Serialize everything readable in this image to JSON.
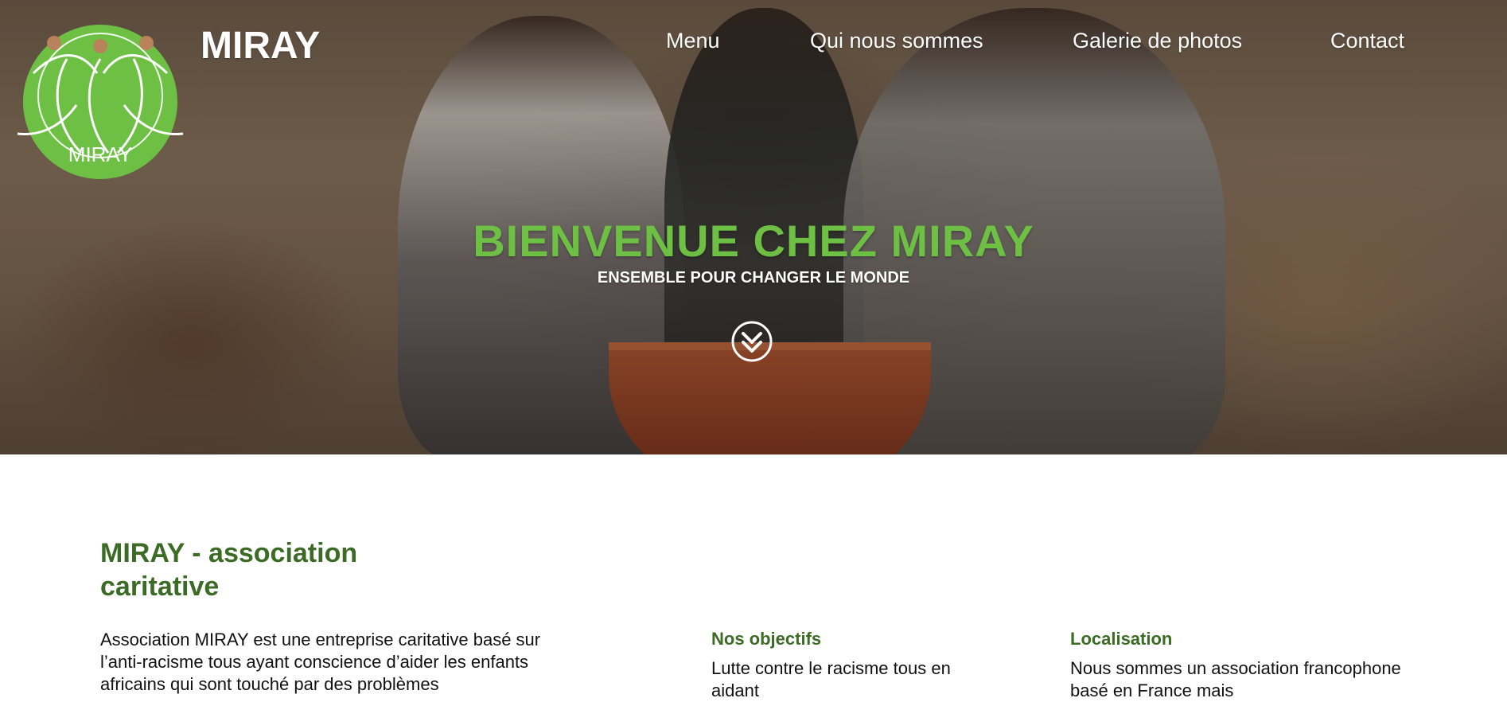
{
  "header": {
    "brand": "MIRAY",
    "logo_text": "MIRAY",
    "nav": [
      {
        "label": "Menu"
      },
      {
        "label": "Qui nous sommes"
      },
      {
        "label": "Galerie de photos"
      },
      {
        "label": "Contact"
      }
    ]
  },
  "hero": {
    "title": "BIENVENUE CHEZ MIRAY",
    "subtitle": "ENSEMBLE POUR CHANGER LE MONDE",
    "scroll_icon": "chevron-double-down-icon"
  },
  "about": {
    "title_line1": "MIRAY - association",
    "title_line2": "caritative",
    "intro": "Association MIRAY est une entreprise caritative basé sur l’anti-racisme tous ayant conscience d’aider les enfants africains qui sont touché par des problèmes"
  },
  "objectives": {
    "title": "Nos objectifs",
    "text": "Lutte contre le racisme tous en aidant"
  },
  "location": {
    "title": "Localisation",
    "text": "Nous sommes un association francophone basé en France mais"
  },
  "colors": {
    "brand_green": "#6ec045",
    "heading_green": "#3b6b25"
  }
}
